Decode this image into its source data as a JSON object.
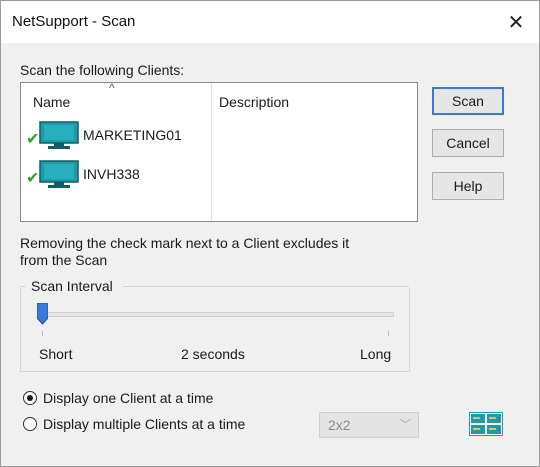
{
  "window": {
    "title": "NetSupport - Scan",
    "close_glyph": "✕"
  },
  "list": {
    "caption": "Scan the following Clients:",
    "columns": {
      "name": "Name",
      "description": "Description"
    },
    "clients": [
      {
        "name": "MARKETING01",
        "description": "",
        "checked": true,
        "icon": "monitor-icon"
      },
      {
        "name": "INVH338",
        "description": "",
        "checked": true,
        "icon": "monitor-icon"
      }
    ]
  },
  "buttons": {
    "scan": "Scan",
    "cancel": "Cancel",
    "help": "Help"
  },
  "hint": {
    "line1": "Removing the check mark next to a Client excludes it",
    "line2": "from the Scan"
  },
  "scan_interval": {
    "label": "Scan Interval",
    "min_label": "Short",
    "max_label": "Long",
    "current_label": "2 seconds",
    "position_fraction": 0
  },
  "display": {
    "option_one": "Display one Client at a time",
    "option_multi": "Display multiple Clients at a time",
    "selected": "one",
    "grid_size": "2x2",
    "grid_icon": "grid-layout-icon"
  },
  "colors": {
    "accent": "#3c78d8",
    "check": "#2aa32a",
    "monitor": "#1f9ba8"
  }
}
